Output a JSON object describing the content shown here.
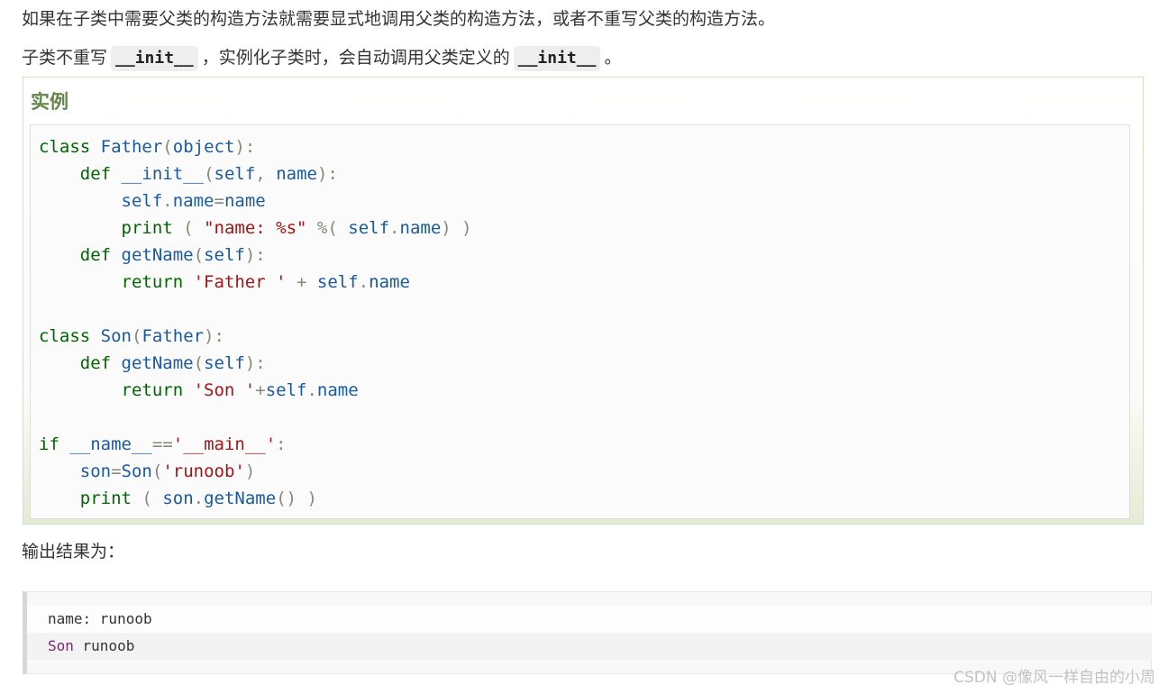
{
  "intro": {
    "line1": "如果在子类中需要父类的构造方法就需要显式地调用父类的构造方法，或者不重写父类的构造方法。",
    "line2_before": "子类不重写",
    "line2_code1": "__init__",
    "line2_middle": "，实例化子类时，会自动调用父类定义的",
    "line2_code2": "__init__",
    "line2_after": "。"
  },
  "example": {
    "title": "实例",
    "code_lines": [
      "class Father(object):",
      "    def __init__(self, name):",
      "        self.name=name",
      "        print ( \"name: %s\" %( self.name) )",
      "    def getName(self):",
      "        return 'Father ' + self.name",
      "",
      "class Son(Father):",
      "    def getName(self):",
      "        return 'Son '+self.name",
      "",
      "if __name__=='__main__':",
      "    son=Son('runoob')",
      "    print ( son.getName() )"
    ]
  },
  "output": {
    "label": "输出结果为：",
    "line1": "name: runoob",
    "line2_son": "Son",
    "line2_rest": " runoob"
  },
  "watermark": "CSDN @像风一样自由的小周",
  "colors": {
    "keyword": "#006600",
    "identifier": "#1a5aa0",
    "string": "#a31515",
    "example_title": "#64854c"
  }
}
